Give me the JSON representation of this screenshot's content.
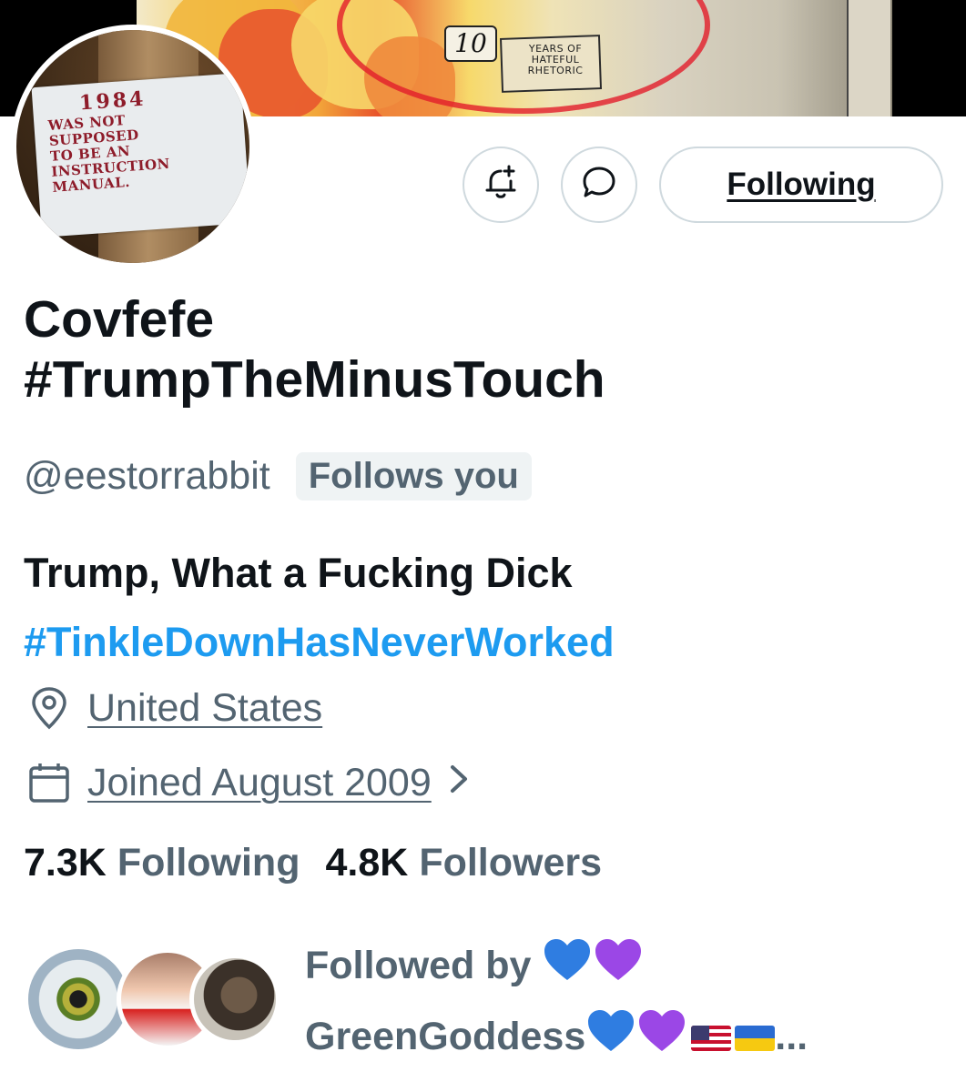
{
  "banner": {
    "number": "10",
    "sign_text": "YEARS OF HATEFUL RHETORIC"
  },
  "avatar": {
    "year": "1984",
    "lines": [
      "WAS NOT",
      "SUPPOSED",
      "TO BE AN",
      "INSTRUCTION",
      "MANUAL."
    ]
  },
  "actions": {
    "notify_icon": "bell-plus-icon",
    "message_icon": "message-icon",
    "following_label": "Following"
  },
  "profile": {
    "name_line1": "Covfefe",
    "name_line2": "#TrumpTheMinusTouch",
    "handle": "@eestorrabbit",
    "follows_you": "Follows you",
    "bio_line1": "Trump, What a Fucking Dick",
    "bio_hashtag": "#TinkleDownHasNeverWorked",
    "location": "United States",
    "joined": "Joined August 2009"
  },
  "stats": {
    "following_count": "7.3K",
    "following_label": "Following",
    "followers_count": "4.8K",
    "followers_label": "Followers"
  },
  "followed_by": {
    "prefix": "Followed by",
    "name": "GreenGoddess",
    "ellipsis": "..."
  },
  "colors": {
    "link_blue": "#1d9bf0",
    "secondary_text": "#536471",
    "border": "#cfd9de",
    "blue_heart": "#2f7de1",
    "purple_heart": "#9b47e6"
  }
}
